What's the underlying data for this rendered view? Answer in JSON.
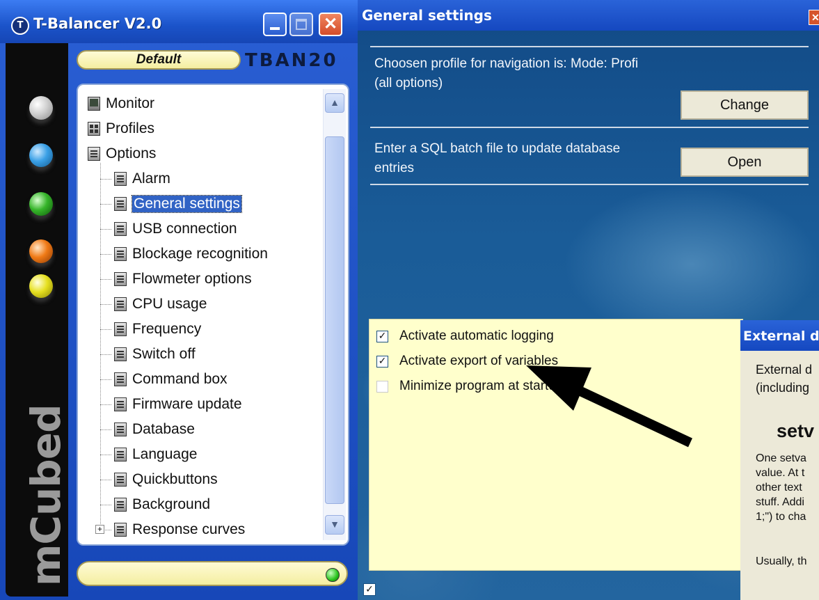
{
  "tbalancer": {
    "title": "T-Balancer V2.0",
    "logo_letter": "T",
    "profile": "Default",
    "device": "TBAN20",
    "brand": "mCubed",
    "close_glyph": "✕",
    "tree": {
      "items": [
        {
          "label": "Monitor"
        },
        {
          "label": "Profiles"
        },
        {
          "label": "Options"
        },
        {
          "label": "Alarm"
        },
        {
          "label": "General settings",
          "selected": true
        },
        {
          "label": "USB connection"
        },
        {
          "label": "Blockage recognition"
        },
        {
          "label": "Flowmeter options"
        },
        {
          "label": "CPU usage"
        },
        {
          "label": "Frequency"
        },
        {
          "label": "Switch off"
        },
        {
          "label": "Command box"
        },
        {
          "label": "Firmware update"
        },
        {
          "label": "Database"
        },
        {
          "label": "Language"
        },
        {
          "label": "Quickbuttons"
        },
        {
          "label": "Background"
        },
        {
          "label": "Response curves"
        }
      ],
      "expander": "+"
    },
    "scroll_up_glyph": "▲",
    "scroll_down_glyph": "▼"
  },
  "general_settings": {
    "title": "General settings",
    "close_glyph": "✕",
    "profile_text_line1": "Choosen profile for navigation is: Mode: Profi",
    "profile_text_line2": "(all options)",
    "change_button": "Change",
    "sql_text_line1": "Enter a SQL batch file to update database",
    "sql_text_line2": "entries",
    "open_button": "Open",
    "checkboxes": [
      {
        "label": "Activate automatic logging",
        "checked": true
      },
      {
        "label": "Activate export of variables",
        "checked": true
      },
      {
        "label": "Minimize program at startup",
        "checked": false
      }
    ],
    "check_glyph": "✓",
    "bottom_checkbox_checked": true
  },
  "external_data": {
    "title": "External d",
    "intro": "External d\n(including",
    "heading": "setv",
    "paragraph": "One setva\nvalue. At t\nother text\nstuff. Addi\n1;\") to cha",
    "usually": "Usually, th"
  },
  "colors": {
    "title_blue": "#1b53c9",
    "selection": "#3163c5",
    "pill_yellow": "#f4eea0",
    "panel_yellow": "#ffffcc",
    "arrow": "#000000"
  }
}
